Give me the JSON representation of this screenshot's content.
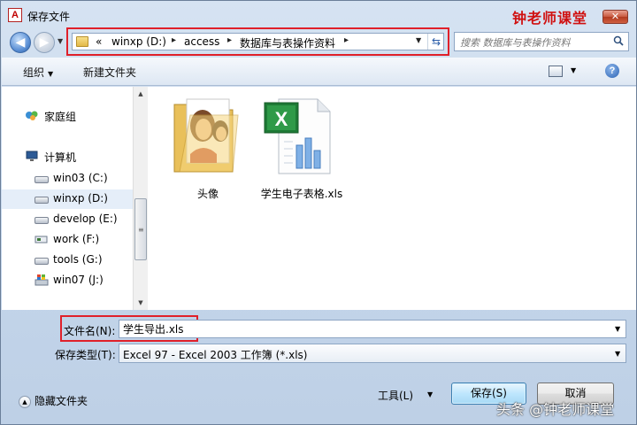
{
  "window": {
    "title": "保存文件",
    "app_icon_letter": "A",
    "watermark_top": "钟老师课堂",
    "close_label": "✕"
  },
  "nav": {
    "back_glyph": "◀",
    "breadcrumb_prefix": "«",
    "breadcrumbs": [
      "winxp (D:)",
      "access",
      "数据库与表操作资料"
    ],
    "search_placeholder": "搜索 数据库与表操作资料"
  },
  "toolbar": {
    "organize_label": "组织",
    "new_folder_label": "新建文件夹",
    "help_label": "?"
  },
  "sidebar": {
    "items": [
      {
        "label": "家庭组",
        "icon": "homegroup-icon"
      },
      {
        "label": "计算机",
        "icon": "computer-icon"
      },
      {
        "label": "win03 (C:)",
        "icon": "drive-icon"
      },
      {
        "label": "winxp (D:)",
        "icon": "drive-icon",
        "selected": true
      },
      {
        "label": "develop (E:)",
        "icon": "drive-icon"
      },
      {
        "label": "work (F:)",
        "icon": "network-drive-icon"
      },
      {
        "label": "tools (G:)",
        "icon": "drive-icon"
      },
      {
        "label": "win07 (J:)",
        "icon": "windows-drive-icon"
      }
    ]
  },
  "files": [
    {
      "label": "头像",
      "icon": "folder-icon"
    },
    {
      "label": "学生电子表格.xls",
      "icon": "excel-file-icon"
    }
  ],
  "form": {
    "filename_label": "文件名(N):",
    "filename_value": "学生导出.xls",
    "filetype_label": "保存类型(T):",
    "filetype_value": "Excel 97 - Excel 2003 工作簿 (*.xls)"
  },
  "footer": {
    "hide_folders_label": "隐藏文件夹",
    "tools_label": "工具(L)",
    "save_label": "保存(S)",
    "cancel_label": "取消",
    "watermark_bottom": "头条 @钟老师课堂"
  },
  "colors": {
    "highlight_red": "#e0202a",
    "excel_green": "#1e7a35",
    "selection_blue": "#e5eef9"
  }
}
